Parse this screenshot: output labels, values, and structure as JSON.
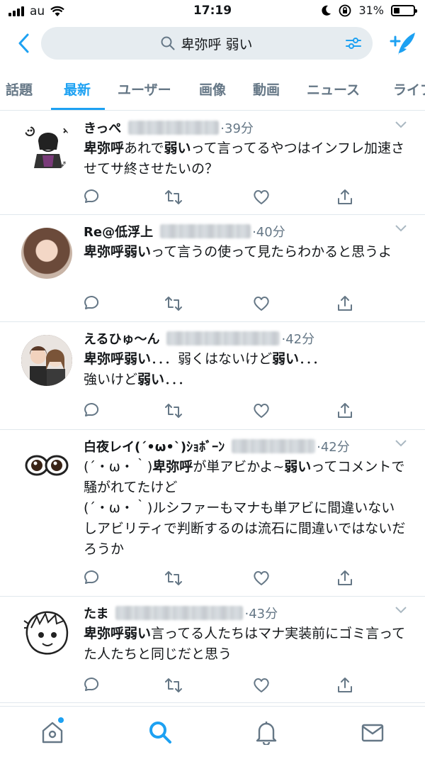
{
  "status_bar": {
    "carrier": "au",
    "time": "17:19",
    "battery": "31%",
    "battery_level": 0.31
  },
  "search": {
    "query": "卑弥呼 弱い"
  },
  "tabs": [
    {
      "label": "話題"
    },
    {
      "label": "最新"
    },
    {
      "label": "ユーザー"
    },
    {
      "label": "画像"
    },
    {
      "label": "動画"
    },
    {
      "label": "ニュース"
    },
    {
      "label": "ライブ"
    }
  ],
  "tweets": [
    {
      "name": "きっぺ",
      "time": "·39分",
      "text": [
        {
          "t": "卑弥呼",
          "b": true
        },
        {
          "t": "あれで",
          "b": false
        },
        {
          "t": "弱い",
          "b": true
        },
        {
          "t": "って言ってるやつはインフレ加速させてサ終させたいの？",
          "b": false
        }
      ]
    },
    {
      "name": "Re@低浮上",
      "time": "·40分",
      "text": [
        {
          "t": "卑弥呼弱い",
          "b": true
        },
        {
          "t": "って言うの使って見たらわかると思うよ",
          "b": false
        }
      ]
    },
    {
      "name": "えるひゅ〜ん",
      "time": "·42分",
      "text": [
        {
          "t": "卑弥呼弱い",
          "b": true
        },
        {
          "t": "．．．弱くはないけど",
          "b": false
        },
        {
          "t": "弱い",
          "b": true
        },
        {
          "t": "．．．\n強いけど",
          "b": false
        },
        {
          "t": "弱い",
          "b": true
        },
        {
          "t": "．．．",
          "b": false
        }
      ]
    },
    {
      "name": "白夜レイ(´•ω•`)ｼｮﾎﾞｰﾝ",
      "time": "·42分",
      "text": [
        {
          "t": "(´・ω・｀)",
          "b": false
        },
        {
          "t": "卑弥呼",
          "b": true
        },
        {
          "t": "が単アビかよ~",
          "b": false
        },
        {
          "t": "弱い",
          "b": true
        },
        {
          "t": "ってコメントで騒がれてたけど\n(´・ω・｀)ルシファーもマナも単アビに間違いないしアビリティで判断するのは流石に間違いではないだろうか",
          "b": false
        }
      ]
    },
    {
      "name": "たま",
      "time": "·43分",
      "text": [
        {
          "t": "卑弥呼弱い",
          "b": true
        },
        {
          "t": "言ってる人たちはマナ実装前にゴミ言ってた人たちと同じだと思う",
          "b": false
        }
      ]
    }
  ],
  "colors": {
    "accent": "#1da1f2",
    "muted": "#657786",
    "search_bg": "#e6ecf0"
  }
}
